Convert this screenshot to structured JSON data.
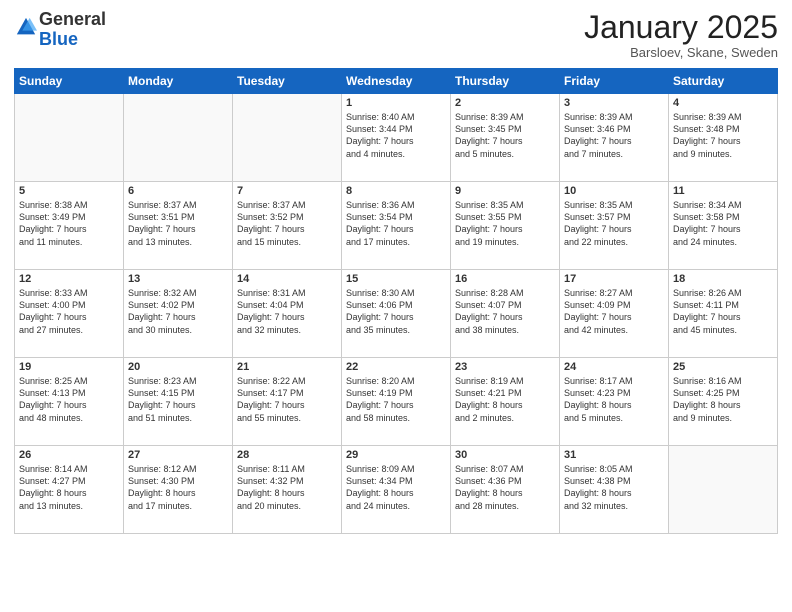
{
  "header": {
    "logo_general": "General",
    "logo_blue": "Blue",
    "month_title": "January 2025",
    "location": "Barsloev, Skane, Sweden"
  },
  "weekdays": [
    "Sunday",
    "Monday",
    "Tuesday",
    "Wednesday",
    "Thursday",
    "Friday",
    "Saturday"
  ],
  "weeks": [
    [
      {
        "day": "",
        "info": ""
      },
      {
        "day": "",
        "info": ""
      },
      {
        "day": "",
        "info": ""
      },
      {
        "day": "1",
        "info": "Sunrise: 8:40 AM\nSunset: 3:44 PM\nDaylight: 7 hours\nand 4 minutes."
      },
      {
        "day": "2",
        "info": "Sunrise: 8:39 AM\nSunset: 3:45 PM\nDaylight: 7 hours\nand 5 minutes."
      },
      {
        "day": "3",
        "info": "Sunrise: 8:39 AM\nSunset: 3:46 PM\nDaylight: 7 hours\nand 7 minutes."
      },
      {
        "day": "4",
        "info": "Sunrise: 8:39 AM\nSunset: 3:48 PM\nDaylight: 7 hours\nand 9 minutes."
      }
    ],
    [
      {
        "day": "5",
        "info": "Sunrise: 8:38 AM\nSunset: 3:49 PM\nDaylight: 7 hours\nand 11 minutes."
      },
      {
        "day": "6",
        "info": "Sunrise: 8:37 AM\nSunset: 3:51 PM\nDaylight: 7 hours\nand 13 minutes."
      },
      {
        "day": "7",
        "info": "Sunrise: 8:37 AM\nSunset: 3:52 PM\nDaylight: 7 hours\nand 15 minutes."
      },
      {
        "day": "8",
        "info": "Sunrise: 8:36 AM\nSunset: 3:54 PM\nDaylight: 7 hours\nand 17 minutes."
      },
      {
        "day": "9",
        "info": "Sunrise: 8:35 AM\nSunset: 3:55 PM\nDaylight: 7 hours\nand 19 minutes."
      },
      {
        "day": "10",
        "info": "Sunrise: 8:35 AM\nSunset: 3:57 PM\nDaylight: 7 hours\nand 22 minutes."
      },
      {
        "day": "11",
        "info": "Sunrise: 8:34 AM\nSunset: 3:58 PM\nDaylight: 7 hours\nand 24 minutes."
      }
    ],
    [
      {
        "day": "12",
        "info": "Sunrise: 8:33 AM\nSunset: 4:00 PM\nDaylight: 7 hours\nand 27 minutes."
      },
      {
        "day": "13",
        "info": "Sunrise: 8:32 AM\nSunset: 4:02 PM\nDaylight: 7 hours\nand 30 minutes."
      },
      {
        "day": "14",
        "info": "Sunrise: 8:31 AM\nSunset: 4:04 PM\nDaylight: 7 hours\nand 32 minutes."
      },
      {
        "day": "15",
        "info": "Sunrise: 8:30 AM\nSunset: 4:06 PM\nDaylight: 7 hours\nand 35 minutes."
      },
      {
        "day": "16",
        "info": "Sunrise: 8:28 AM\nSunset: 4:07 PM\nDaylight: 7 hours\nand 38 minutes."
      },
      {
        "day": "17",
        "info": "Sunrise: 8:27 AM\nSunset: 4:09 PM\nDaylight: 7 hours\nand 42 minutes."
      },
      {
        "day": "18",
        "info": "Sunrise: 8:26 AM\nSunset: 4:11 PM\nDaylight: 7 hours\nand 45 minutes."
      }
    ],
    [
      {
        "day": "19",
        "info": "Sunrise: 8:25 AM\nSunset: 4:13 PM\nDaylight: 7 hours\nand 48 minutes."
      },
      {
        "day": "20",
        "info": "Sunrise: 8:23 AM\nSunset: 4:15 PM\nDaylight: 7 hours\nand 51 minutes."
      },
      {
        "day": "21",
        "info": "Sunrise: 8:22 AM\nSunset: 4:17 PM\nDaylight: 7 hours\nand 55 minutes."
      },
      {
        "day": "22",
        "info": "Sunrise: 8:20 AM\nSunset: 4:19 PM\nDaylight: 7 hours\nand 58 minutes."
      },
      {
        "day": "23",
        "info": "Sunrise: 8:19 AM\nSunset: 4:21 PM\nDaylight: 8 hours\nand 2 minutes."
      },
      {
        "day": "24",
        "info": "Sunrise: 8:17 AM\nSunset: 4:23 PM\nDaylight: 8 hours\nand 5 minutes."
      },
      {
        "day": "25",
        "info": "Sunrise: 8:16 AM\nSunset: 4:25 PM\nDaylight: 8 hours\nand 9 minutes."
      }
    ],
    [
      {
        "day": "26",
        "info": "Sunrise: 8:14 AM\nSunset: 4:27 PM\nDaylight: 8 hours\nand 13 minutes."
      },
      {
        "day": "27",
        "info": "Sunrise: 8:12 AM\nSunset: 4:30 PM\nDaylight: 8 hours\nand 17 minutes."
      },
      {
        "day": "28",
        "info": "Sunrise: 8:11 AM\nSunset: 4:32 PM\nDaylight: 8 hours\nand 20 minutes."
      },
      {
        "day": "29",
        "info": "Sunrise: 8:09 AM\nSunset: 4:34 PM\nDaylight: 8 hours\nand 24 minutes."
      },
      {
        "day": "30",
        "info": "Sunrise: 8:07 AM\nSunset: 4:36 PM\nDaylight: 8 hours\nand 28 minutes."
      },
      {
        "day": "31",
        "info": "Sunrise: 8:05 AM\nSunset: 4:38 PM\nDaylight: 8 hours\nand 32 minutes."
      },
      {
        "day": "",
        "info": ""
      }
    ]
  ]
}
